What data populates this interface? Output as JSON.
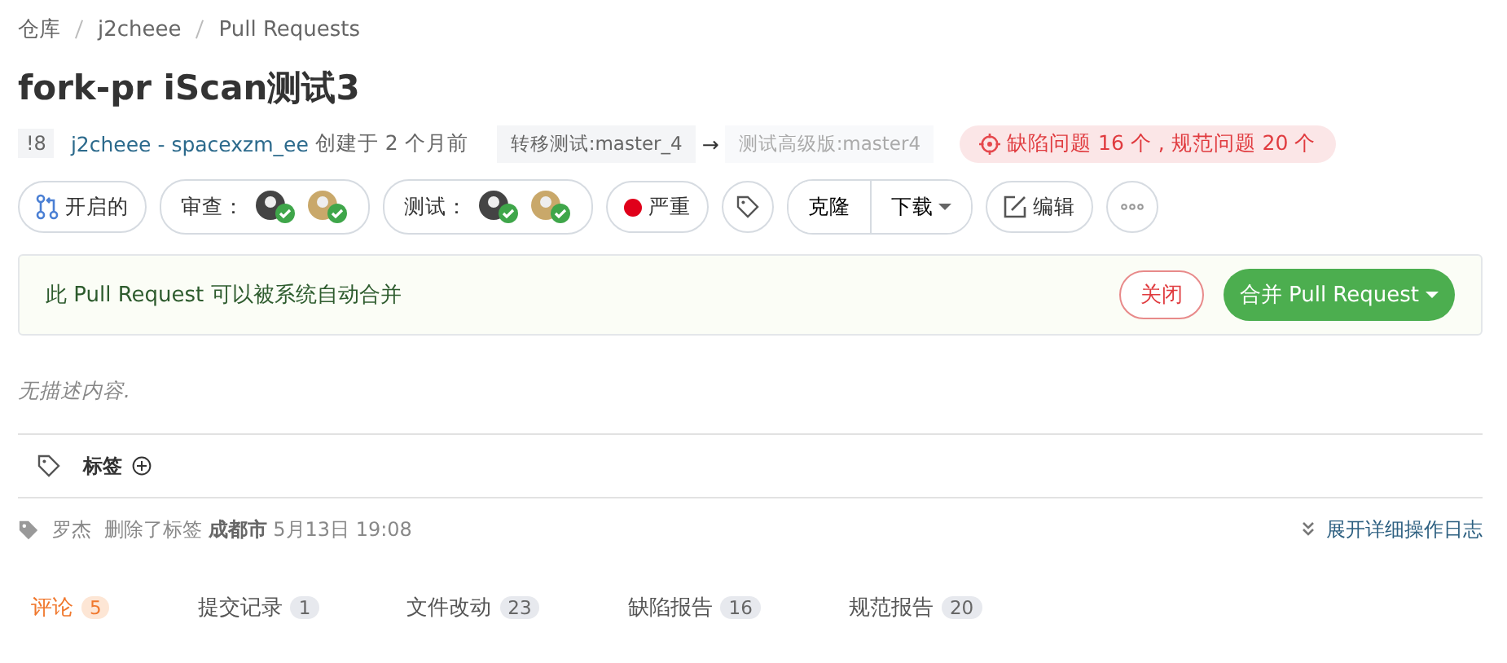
{
  "breadcrumb": [
    "仓库",
    "j2cheee",
    "Pull Requests"
  ],
  "title": "fork-pr iScan测试3",
  "meta": {
    "number": "!8",
    "author": "j2cheee - spacexzm_ee",
    "created": "创建于 2 个月前",
    "source_branch": "转移测试:master_4",
    "arrow": "→",
    "target_branch": "测试高级版:master4",
    "issues": "缺陷问题 16 个 , 规范问题 20 个"
  },
  "actions": [
    {
      "kind": "status",
      "label": "开启的"
    },
    {
      "kind": "people",
      "label": "审查：",
      "avatars": [
        {
          "approved": true
        },
        {
          "approved": true
        }
      ]
    },
    {
      "kind": "people",
      "label": "测试：",
      "avatars": [
        {
          "approved": true
        },
        {
          "approved": true
        }
      ]
    },
    {
      "kind": "priority",
      "label": "严重"
    },
    {
      "kind": "tag"
    },
    {
      "kind": "split",
      "label": "克隆",
      "menu": "下载"
    },
    {
      "kind": "edit",
      "label": "编辑"
    },
    {
      "kind": "more"
    }
  ],
  "merge": {
    "message": "此 Pull Request 可以被系统自动合并",
    "close": "关闭",
    "merge": "合并 Pull Request"
  },
  "description": "无描述内容.",
  "labels": {
    "title": "标签"
  },
  "log": {
    "user": "罗杰",
    "action": "删除了标签",
    "label": "成都市",
    "time": "5月13日 19:08",
    "expand": "展开详细操作日志"
  },
  "tabs": [
    {
      "label": "评论",
      "count": "5",
      "selected": true
    },
    {
      "label": "提交记录",
      "count": "1",
      "selected": false
    },
    {
      "label": "文件改动",
      "count": "23",
      "selected": false
    },
    {
      "label": "缺陷报告",
      "count": "16",
      "selected": false
    },
    {
      "label": "规范报告",
      "count": "20",
      "selected": false
    }
  ]
}
